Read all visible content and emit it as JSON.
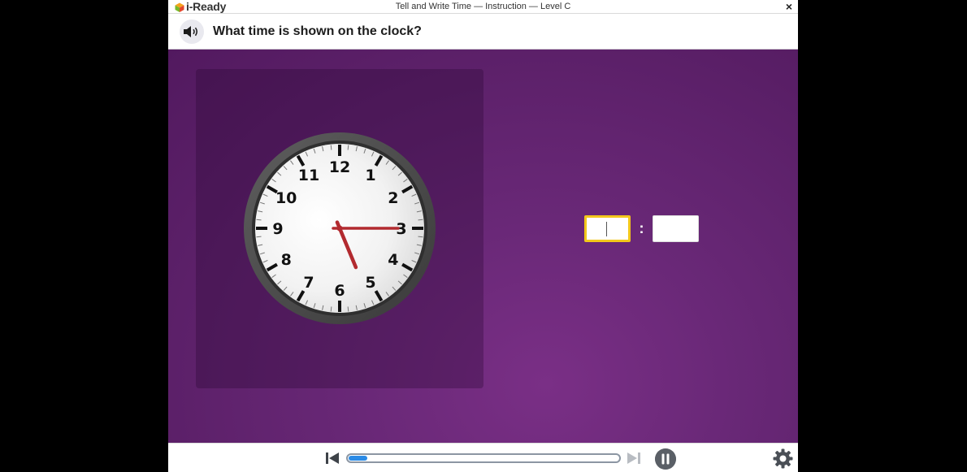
{
  "window": {
    "logo_text": "i-Ready",
    "title": "Tell and Write Time — Instruction — Level C",
    "close_symbol": "×"
  },
  "question": {
    "text": "What time is shown on the clock?",
    "speaker_icon": "speaker-icon"
  },
  "clock": {
    "numbers": [
      "12",
      "1",
      "2",
      "3",
      "4",
      "5",
      "6",
      "7",
      "8",
      "9",
      "10",
      "11"
    ],
    "hour": 5,
    "minute": 15,
    "hand_color": "#b22a2f"
  },
  "answer": {
    "hour_value": "",
    "minute_value": "",
    "separator": ":"
  },
  "player": {
    "progress": 0.07,
    "icons": [
      "skip-back-icon",
      "skip-forward-icon",
      "pause-icon",
      "gear-icon"
    ]
  },
  "colors": {
    "background": "#612270",
    "panel": "#4e1a5c",
    "input_focus_border": "#f2c71b",
    "progress_fill": "#2b8be6"
  }
}
